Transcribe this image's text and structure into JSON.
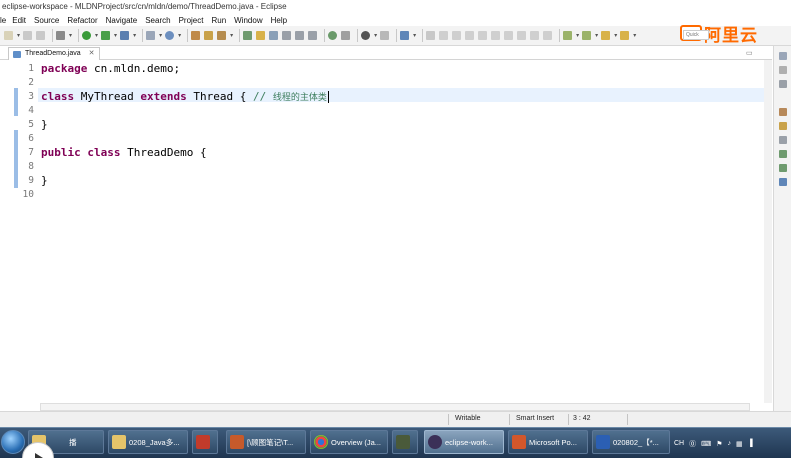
{
  "window": {
    "title": "eclipse-workspace - MLDNProject/src/cn/mldn/demo/ThreadDemo.java - Eclipse"
  },
  "menu": [
    "le",
    "Edit",
    "Source",
    "Refactor",
    "Navigate",
    "Search",
    "Project",
    "Run",
    "Window",
    "Help"
  ],
  "brand": {
    "name": "阿里云",
    "quick_access": "Quick"
  },
  "editor": {
    "tab_label": "ThreadDemo.java",
    "line_numbers": [
      "1",
      "2",
      "3",
      "4",
      "5",
      "6",
      "7",
      "8",
      "9",
      "10"
    ],
    "lines": {
      "l1_kw": "package",
      "l1_rest": " cn.mldn.demo;",
      "l3_kw1": "class",
      "l3_mid": " MyThread ",
      "l3_kw2": "extends",
      "l3_rest": " Thread { ",
      "l3_comment_slash": "// ",
      "l3_comment_text": "线程的主体类",
      "l5": "}",
      "l7_kw1": "public",
      "l7_kw2": "class",
      "l7_rest": " ThreadDemo {",
      "l9": "}"
    }
  },
  "status": {
    "writable": "Writable",
    "insert_mode": "Smart Insert",
    "position": "3 : 42"
  },
  "taskbar": {
    "items": [
      {
        "label": "播"
      },
      {
        "label": "0208_Java多..."
      },
      {
        "label": ""
      },
      {
        "label": "[\\顾图笔记\\T..."
      },
      {
        "label": "Overview (Ja..."
      },
      {
        "label": ""
      },
      {
        "label": "eclipse-work..."
      },
      {
        "label": "Microsoft Po..."
      },
      {
        "label": "020802_【*..."
      }
    ],
    "tray_lang": "CH"
  },
  "colors": {
    "keyword": "#7f0055",
    "comment": "#3f7f5f",
    "current_line": "#e8f2fe",
    "change_bar": "#9bbde6",
    "brand": "#ff6a00"
  }
}
